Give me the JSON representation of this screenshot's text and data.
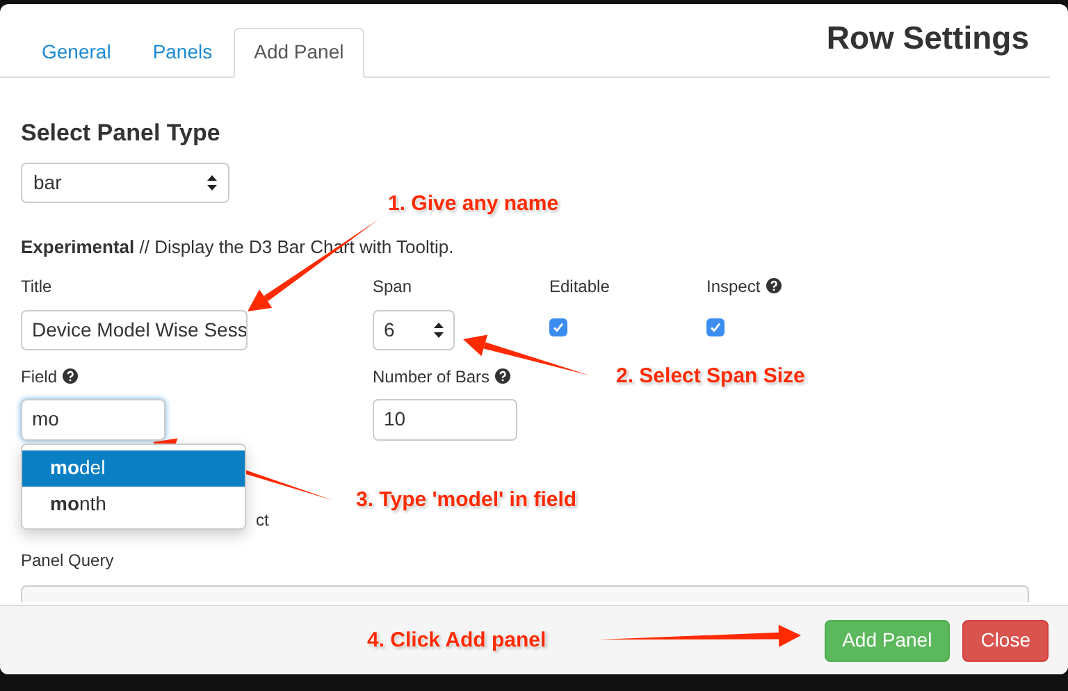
{
  "dialog": {
    "title": "Row Settings"
  },
  "tabs": [
    {
      "label": "General",
      "selected": false
    },
    {
      "label": "Panels",
      "selected": false
    },
    {
      "label": "Add Panel",
      "selected": true
    }
  ],
  "panel_type": {
    "heading": "Select Panel Type",
    "value": "bar"
  },
  "description": {
    "text": "**Experimental** // Display the D3 Bar Chart with Tooltip."
  },
  "fields": {
    "title": {
      "label": "Title",
      "value": "Device Model Wise Sess"
    },
    "span": {
      "label": "Span",
      "value": "6"
    },
    "editable": {
      "label": "Editable",
      "checked": true
    },
    "inspect": {
      "label": "Inspect",
      "checked": true
    },
    "field": {
      "label": "Field",
      "value": "mo"
    },
    "bars": {
      "label": "Number of Bars",
      "value": "10"
    }
  },
  "suggestions": [
    {
      "match": "mo",
      "rest": "del",
      "selected": true
    },
    {
      "match": "mo",
      "rest": "nth",
      "selected": false
    }
  ],
  "hidden_option_tail": "ct",
  "panel_query": {
    "label": "Panel Query"
  },
  "annotations": [
    "1. Give any  name",
    "2. Select Span Size",
    "3. Type 'model' in field",
    "4. Click Add panel"
  ],
  "buttons": [
    {
      "label": "Add Panel",
      "kind": "primary"
    },
    {
      "label": "Close",
      "kind": "danger"
    }
  ]
}
